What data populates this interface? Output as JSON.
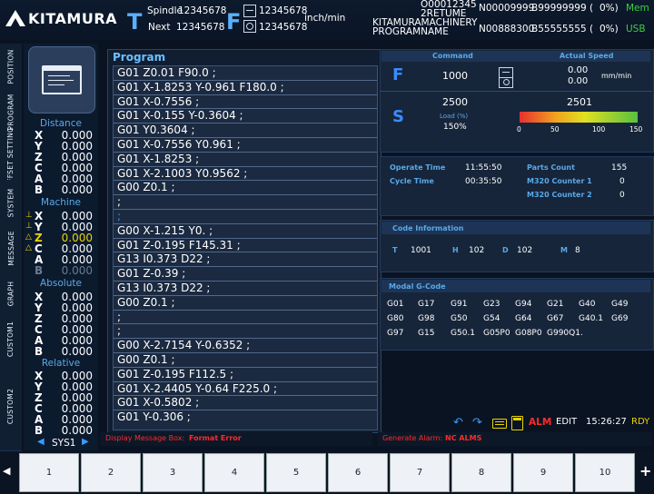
{
  "header": {
    "brand": "KITAMURA",
    "spindle_label": "Spindle",
    "spindle_value": "12345678",
    "next_label": "Next",
    "next_value": "12345678",
    "t_letter": "T",
    "f_letter": "F",
    "feed_value_1": "12345678",
    "feed_value_2": "12345678",
    "feed_unit": "inch/min",
    "prog_1": "O00012345",
    "prog_2": "2RETUME",
    "prog_3": "KITAMURAMACHINERY",
    "prog_4": "PROGRAMNAME",
    "counter_n1": "N00009999",
    "counter_b1": "B99999999 (",
    "counter_pct1": "0%)",
    "counter_n2": "N00888300",
    "counter_b2": "B55555555 (",
    "counter_pct2": "0%)",
    "mem_label": "Mem",
    "usb_label": "USB"
  },
  "sidetabs": [
    "POSITION",
    "PROGRAM",
    "OFFSET SETTING",
    "SYSTEM",
    "MESSAGE",
    "GRAPH",
    "CUSTOM1",
    "CUSTOM2"
  ],
  "axes": {
    "distance_title": "Distance",
    "machine_title": "Machine",
    "absolute_title": "Absolute",
    "relative_title": "Relative",
    "labels": [
      "X",
      "Y",
      "Z",
      "C",
      "A",
      "B"
    ],
    "distance": [
      "0.000",
      "0.000",
      "0.000",
      "0.000",
      "0.000",
      "0.000"
    ],
    "machine": [
      "0.000",
      "0.000",
      "0.000",
      "0.000",
      "0.000",
      "0.000"
    ],
    "absolute": [
      "0.000",
      "0.000",
      "0.000",
      "0.000",
      "0.000",
      "0.000"
    ],
    "relative": [
      "0.000",
      "0.000",
      "0.000",
      "0.000",
      "0.000",
      "0.000"
    ],
    "sys_label": "SYS1"
  },
  "program": {
    "title": "Program",
    "lines": [
      "G01 Z0.01 F90.0 ;",
      "G01 X-1.8253 Y-0.961 F180.0 ;",
      "G01 X-0.7556 ;",
      "G01 X-0.155 Y-0.3604 ;",
      "G01 Y0.3604 ;",
      "G01 X-0.7556 Y0.961 ;",
      "G01 X-1.8253 ;",
      "G01 X-2.1003 Y0.9562 ;",
      "G00 Z0.1 ;",
      ";",
      ";",
      "G00 X-1.215 Y0. ;",
      "G01 Z-0.195 F145.31 ;",
      "G13 I0.373 D22 ;",
      "G01 Z-0.39 ;",
      "G13 I0.373 D22 ;",
      "G00 Z0.1 ;",
      ";",
      ";",
      "G00 X-2.7154 Y-0.6352 ;",
      "G00 Z0.1 ;",
      "G01 Z-0.195 F112.5 ;",
      "G01 X-2.4405 Y-0.64 F225.0 ;",
      "G01 X-0.5802 ;",
      "G01 Y-0.306 ;"
    ]
  },
  "feed": {
    "command_title": "Command",
    "actual_title": "Actual Speed",
    "f_letter": "F",
    "command_value": "1000",
    "actual_1": "0.00",
    "actual_2": "0.00",
    "unit": "mm/min",
    "s_letter": "S",
    "s_command": "2500",
    "s_actual": "2501",
    "load_label": "Load (%)",
    "load_value": "150%",
    "scale": [
      "0",
      "50",
      "100",
      "150"
    ]
  },
  "times": {
    "operate_label": "Operate Time",
    "operate_value": "11:55:50",
    "cycle_label": "Cycle Time",
    "cycle_value": "00:35:50",
    "parts_label": "Parts Count",
    "parts_value": "155",
    "c1_label": "M320 Counter 1",
    "c1_value": "0",
    "c2_label": "M320 Counter 2",
    "c2_value": "0"
  },
  "code_info": {
    "title": "Code Information",
    "t_label": "T",
    "t_value": "1001",
    "h_label": "H",
    "h_value": "102",
    "d_label": "D",
    "d_value": "102",
    "m_label": "M",
    "m_value": "8"
  },
  "modal": {
    "title": "Modal G-Code",
    "rows": [
      [
        "G01",
        "G17",
        "G91",
        "G23",
        "G94",
        "G21",
        "G40",
        "G49"
      ],
      [
        "G80",
        "G98",
        "G50",
        "G54",
        "G64",
        "G67",
        "G40.1",
        "G69"
      ],
      [
        "G97",
        "G15",
        "G50.1",
        "G05P0",
        "G08P0",
        "G990Q1.",
        "",
        ""
      ]
    ]
  },
  "status": {
    "alm": "ALM",
    "mode": "EDIT",
    "time": "15:26:27",
    "rdy": "RDY",
    "display_msg_label": "Display Message Box:",
    "display_msg_value": "Format Error",
    "alarm_label": "Generate Alarm:",
    "alarm_value": "NC ALMS"
  },
  "fkeys": [
    "1",
    "2",
    "3",
    "4",
    "5",
    "6",
    "7",
    "8",
    "9",
    "10"
  ],
  "colors": {
    "accent": "#5aa9e8",
    "alarm": "#ff2a2a",
    "mem": "#3ccf3c",
    "highlight": "#e8d400"
  }
}
